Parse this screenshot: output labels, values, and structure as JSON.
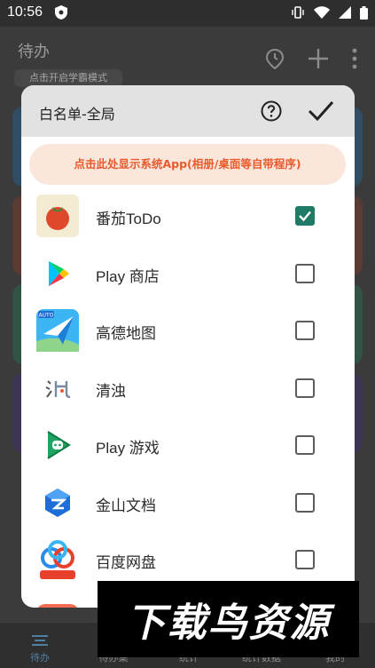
{
  "status_bar": {
    "time": "10:56"
  },
  "background_app": {
    "title": "待办",
    "mode_button": "点击开启学霸模式",
    "bottom_nav": [
      {
        "label": "待办",
        "active": true
      },
      {
        "label": "待办集",
        "active": false
      },
      {
        "label": "统计",
        "active": false
      },
      {
        "label": "统计数据",
        "active": false
      },
      {
        "label": "我的",
        "active": false
      }
    ]
  },
  "dialog": {
    "title": "白名单-全局",
    "system_apps_button": "点击此处显示系统App(相册/桌面等自带程序)",
    "apps": [
      {
        "name": "番茄ToDo",
        "icon": "tomato-icon",
        "checked": true
      },
      {
        "name": "Play 商店",
        "icon": "play-store-icon",
        "checked": false
      },
      {
        "name": "高德地图",
        "icon": "amap-icon",
        "checked": false
      },
      {
        "name": "清浊",
        "icon": "qingzhuo-icon",
        "checked": false
      },
      {
        "name": "Play 游戏",
        "icon": "play-games-icon",
        "checked": false
      },
      {
        "name": "金山文档",
        "icon": "kingsoft-docs-icon",
        "checked": false
      },
      {
        "name": "百度网盘",
        "icon": "baidu-netdisk-icon",
        "checked": false
      }
    ]
  },
  "watermark": {
    "text": "下载鸟资源"
  },
  "colors": {
    "accent_green": "#1f7a66",
    "system_button_bg": "#fbe6dc",
    "system_button_text": "#e85a2c",
    "dialog_header_bg": "#e2e2e2"
  }
}
